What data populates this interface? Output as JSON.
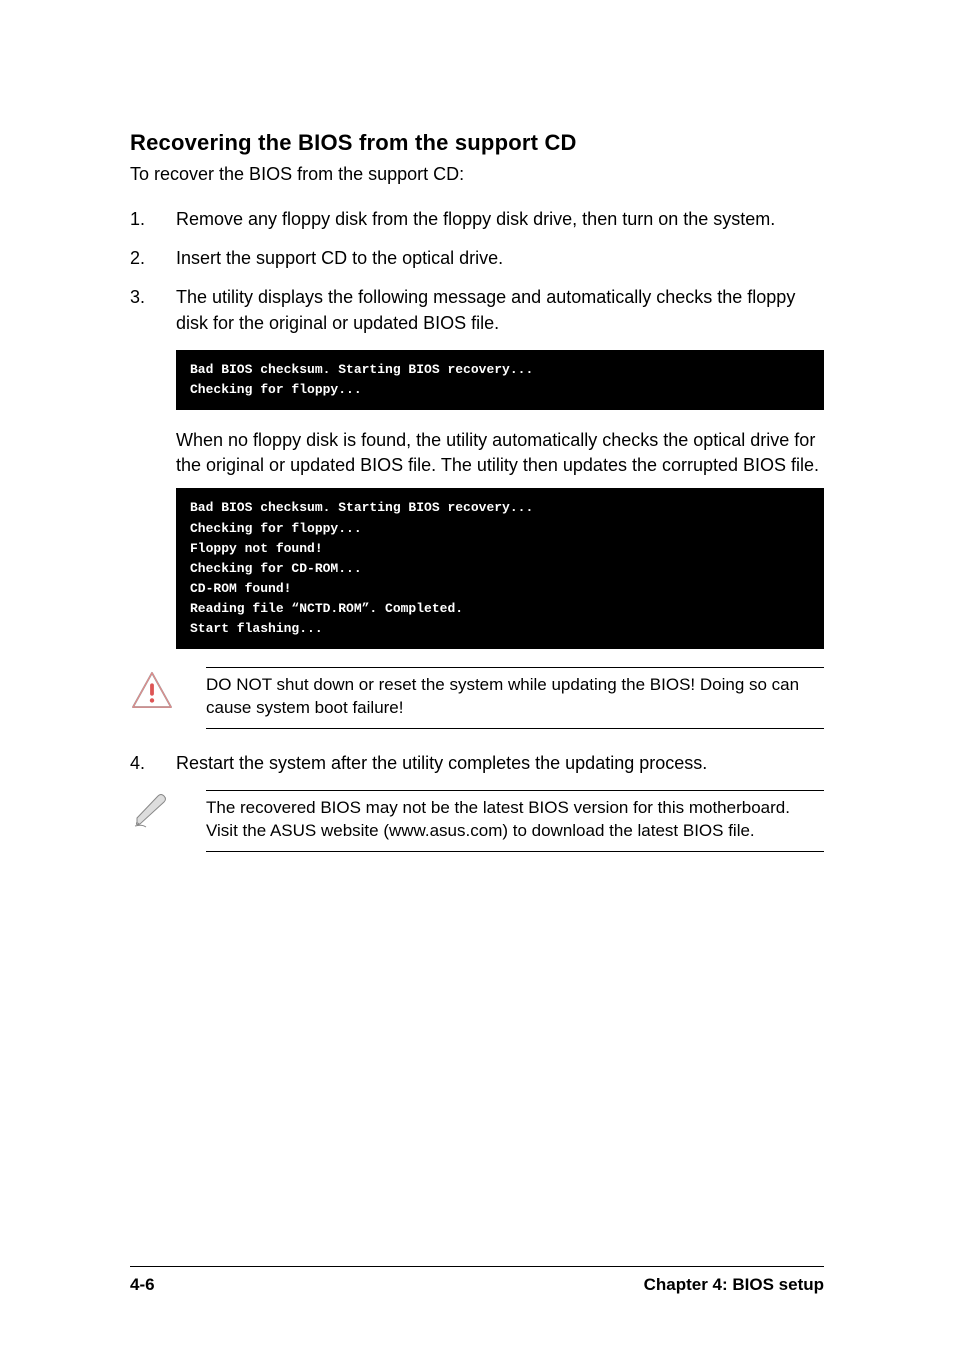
{
  "heading": "Recovering the BIOS from the support CD",
  "intro": "To recover the BIOS from the support CD:",
  "steps": {
    "s1num": "1.",
    "s1": "Remove any floppy disk from the floppy disk drive, then turn on the system.",
    "s2num": "2.",
    "s2": "Insert the support CD to the optical drive.",
    "s3num": "3.",
    "s3": "The utility displays the following message and automatically checks the floppy disk for the original or updated BIOS file.",
    "s4num": "4.",
    "s4": "Restart the system after the utility completes the updating process."
  },
  "code1": "Bad BIOS checksum. Starting BIOS recovery...\nChecking for floppy...",
  "midpara": "When no floppy disk is found, the utility automatically checks the optical drive for the original or updated BIOS file. The utility then updates the corrupted BIOS file.",
  "code2": "Bad BIOS checksum. Starting BIOS recovery...\nChecking for floppy...\nFloppy not found!\nChecking for CD-ROM...\nCD-ROM found!\nReading file “NCTD.ROM”. Completed.\nStart flashing...",
  "warning": "DO NOT shut down or reset the system while updating the BIOS! Doing so can cause system boot failure!",
  "note": "The recovered BIOS may not be the latest BIOS version for this motherboard. Visit the ASUS website (www.asus.com) to download the latest BIOS file.",
  "footer_left": "4-6",
  "footer_right": "Chapter 4: BIOS setup"
}
